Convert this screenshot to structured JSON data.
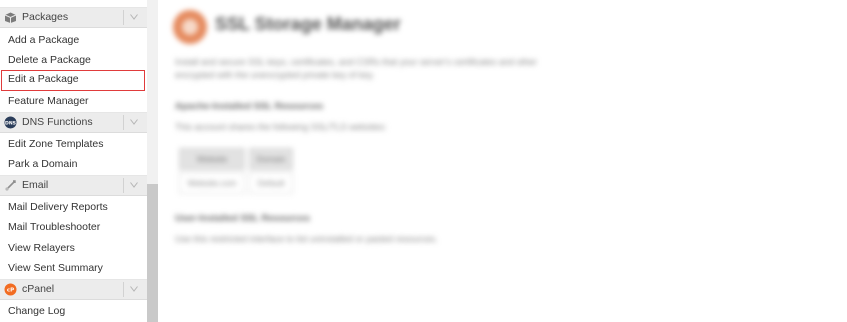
{
  "sidebar": {
    "sections": [
      {
        "label": "Packages",
        "icon": "package-icon",
        "items": [
          "Add a Package",
          "Delete a Package",
          "Edit a Package",
          "Feature Manager"
        ]
      },
      {
        "label": "DNS Functions",
        "icon": "dns-icon",
        "items": [
          "Edit Zone Templates",
          "Park a Domain"
        ]
      },
      {
        "label": "Email",
        "icon": "email-icon",
        "items": [
          "Mail Delivery Reports",
          "Mail Troubleshooter",
          "View Relayers",
          "View Sent Summary"
        ]
      },
      {
        "label": "cPanel",
        "icon": "cpanel-icon",
        "items": [
          "Change Log"
        ]
      }
    ],
    "active_item": "Edit a Package"
  },
  "main": {
    "title": "SSL Storage Manager",
    "description_line1": "Install and secure SSL keys, certificates, and CSRs that your server's certificates and other",
    "description_line2": "encrypted with the unencrypted private key of key.",
    "section1_heading": "Apache-Installed SSL Resources",
    "section1_text": "This account shares the following SSL/TLS websites:",
    "table_headers": [
      "Website",
      "Domain"
    ],
    "table_row": [
      "Website.com",
      "Default"
    ],
    "section2_heading": "User-Installed SSL Resources",
    "section2_text": "Use this restricted interface to list uninstalled or pasted resources."
  },
  "colors": {
    "active_outline": "#e03b3b",
    "cpanel_orange": "#f26c22",
    "section_bg": "#ececec"
  }
}
